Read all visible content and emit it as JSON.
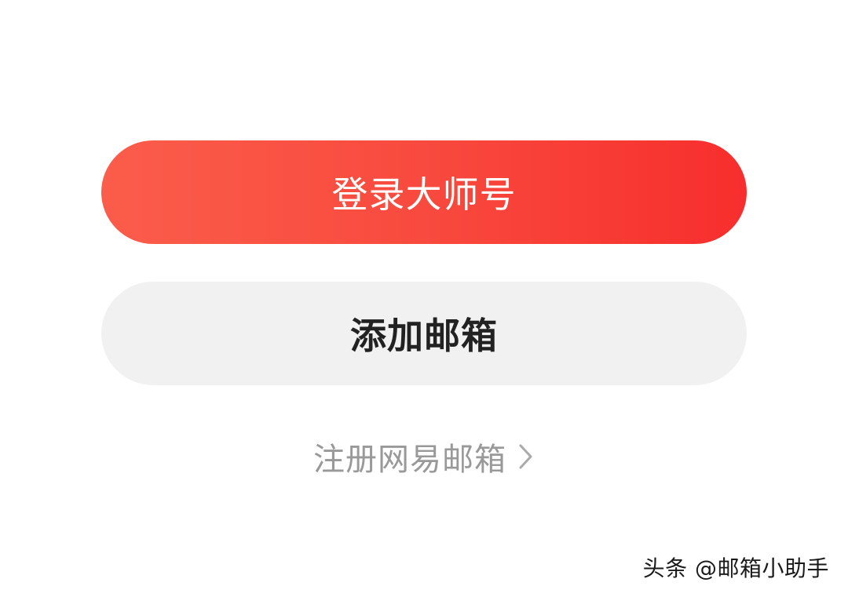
{
  "buttons": {
    "login_master": "登录大师号",
    "add_mailbox": "添加邮箱"
  },
  "register_link": {
    "label": "注册网易邮箱",
    "icon": "chevron-right-icon"
  },
  "watermark": "头条 @邮箱小助手",
  "colors": {
    "primary_gradient_start": "#fb5d4b",
    "primary_gradient_end": "#f72e2d",
    "primary_text": "#ffffff",
    "secondary_bg": "#f1f1f1",
    "secondary_text": "#222222",
    "link_text": "#999999"
  }
}
